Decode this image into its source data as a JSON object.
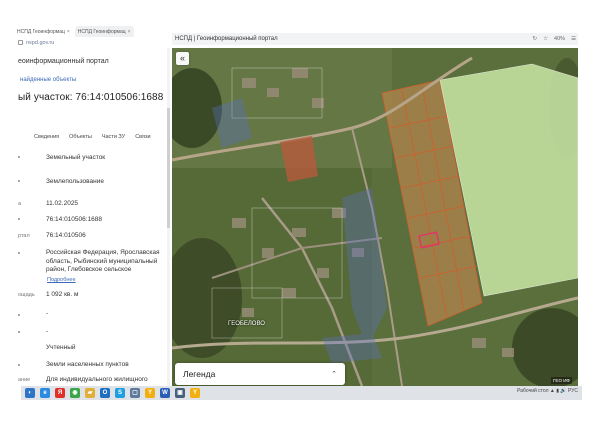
{
  "left_browser": {
    "tabs": [
      {
        "label": "НСПД Геоинформац",
        "active": true
      },
      {
        "label": "НСПД Геоинформац",
        "active": false
      }
    ],
    "address": "nspd.gov.ru"
  },
  "left_panel": {
    "portal_title": "еоинформационный портал",
    "found_link": "найденные объекты",
    "parcel_title": "ый участок: 76:14:010506:1688",
    "tabs": [
      "Сведения",
      "Объекты",
      "Части ЗУ",
      "Связи"
    ],
    "fields": [
      {
        "label": "",
        "value": "Земельный участок"
      },
      {
        "label": "",
        "value": "Землепользование"
      },
      {
        "label": "а",
        "value": "11.02.2025"
      },
      {
        "label": "",
        "value": "76:14:010506:1688"
      },
      {
        "label": "ртал",
        "value": "76:14:010506"
      },
      {
        "label": "",
        "value": "Российская Федерация, Ярославская область, Рыбинский муниципальный район, Глебовское сельское"
      },
      {
        "label": "",
        "link": "Подробнее"
      },
      {
        "label": "ощадь",
        "value": "1 092 кв. м"
      },
      {
        "label": "",
        "value": "-"
      },
      {
        "label": "",
        "value": "-"
      },
      {
        "label": "",
        "value": "Учтенный"
      },
      {
        "label": "",
        "value": "Земли населенных пунктов"
      },
      {
        "label": "ание",
        "value": "Для индивидуального жилищного"
      }
    ]
  },
  "right_browser": {
    "title": "НСПД | Геоинформационный портал",
    "controls": [
      "↻",
      "☆",
      "40%",
      "☰"
    ]
  },
  "map": {
    "collapse_icon": "«",
    "legend_label": "Легенда",
    "legend_chevron": "⌃",
    "scale_text": "ГЕО ИФ",
    "road_label": "ГЕОБЕЛОВО"
  },
  "colors": {
    "parcel_orange": "#d65a2a",
    "parcel_highlight": "#e2336b",
    "field_green": "#c9e7a6",
    "link_blue": "#3b6bb8"
  },
  "taskbar": {
    "icons": [
      {
        "name": "start-icon",
        "glyph": "◐",
        "color": "#2b74c7"
      },
      {
        "name": "ie-icon",
        "glyph": "e",
        "color": "#2a8be0"
      },
      {
        "name": "yandex-icon",
        "glyph": "Я",
        "color": "#e0302a"
      },
      {
        "name": "chrome-icon",
        "glyph": "◉",
        "color": "#3aa54a"
      },
      {
        "name": "folder-icon",
        "glyph": "▰",
        "color": "#e1b03a"
      },
      {
        "name": "outlook-icon",
        "glyph": "O",
        "color": "#1e6fbf"
      },
      {
        "name": "skype-icon",
        "glyph": "S",
        "color": "#1ea0e0"
      },
      {
        "name": "monitor-icon",
        "glyph": "▢",
        "color": "#5e7a9a"
      },
      {
        "name": "yandex-browser-icon",
        "glyph": "Y",
        "color": "#f2b010"
      },
      {
        "name": "word-icon",
        "glyph": "W",
        "color": "#2b5fb6"
      },
      {
        "name": "window-icon",
        "glyph": "▣",
        "color": "#47607c"
      },
      {
        "name": "yandex-disk-icon",
        "glyph": "Y",
        "color": "#f2b010"
      }
    ],
    "tray": "Рабочий стол  ▲ ▮ 🔊 РУС"
  }
}
